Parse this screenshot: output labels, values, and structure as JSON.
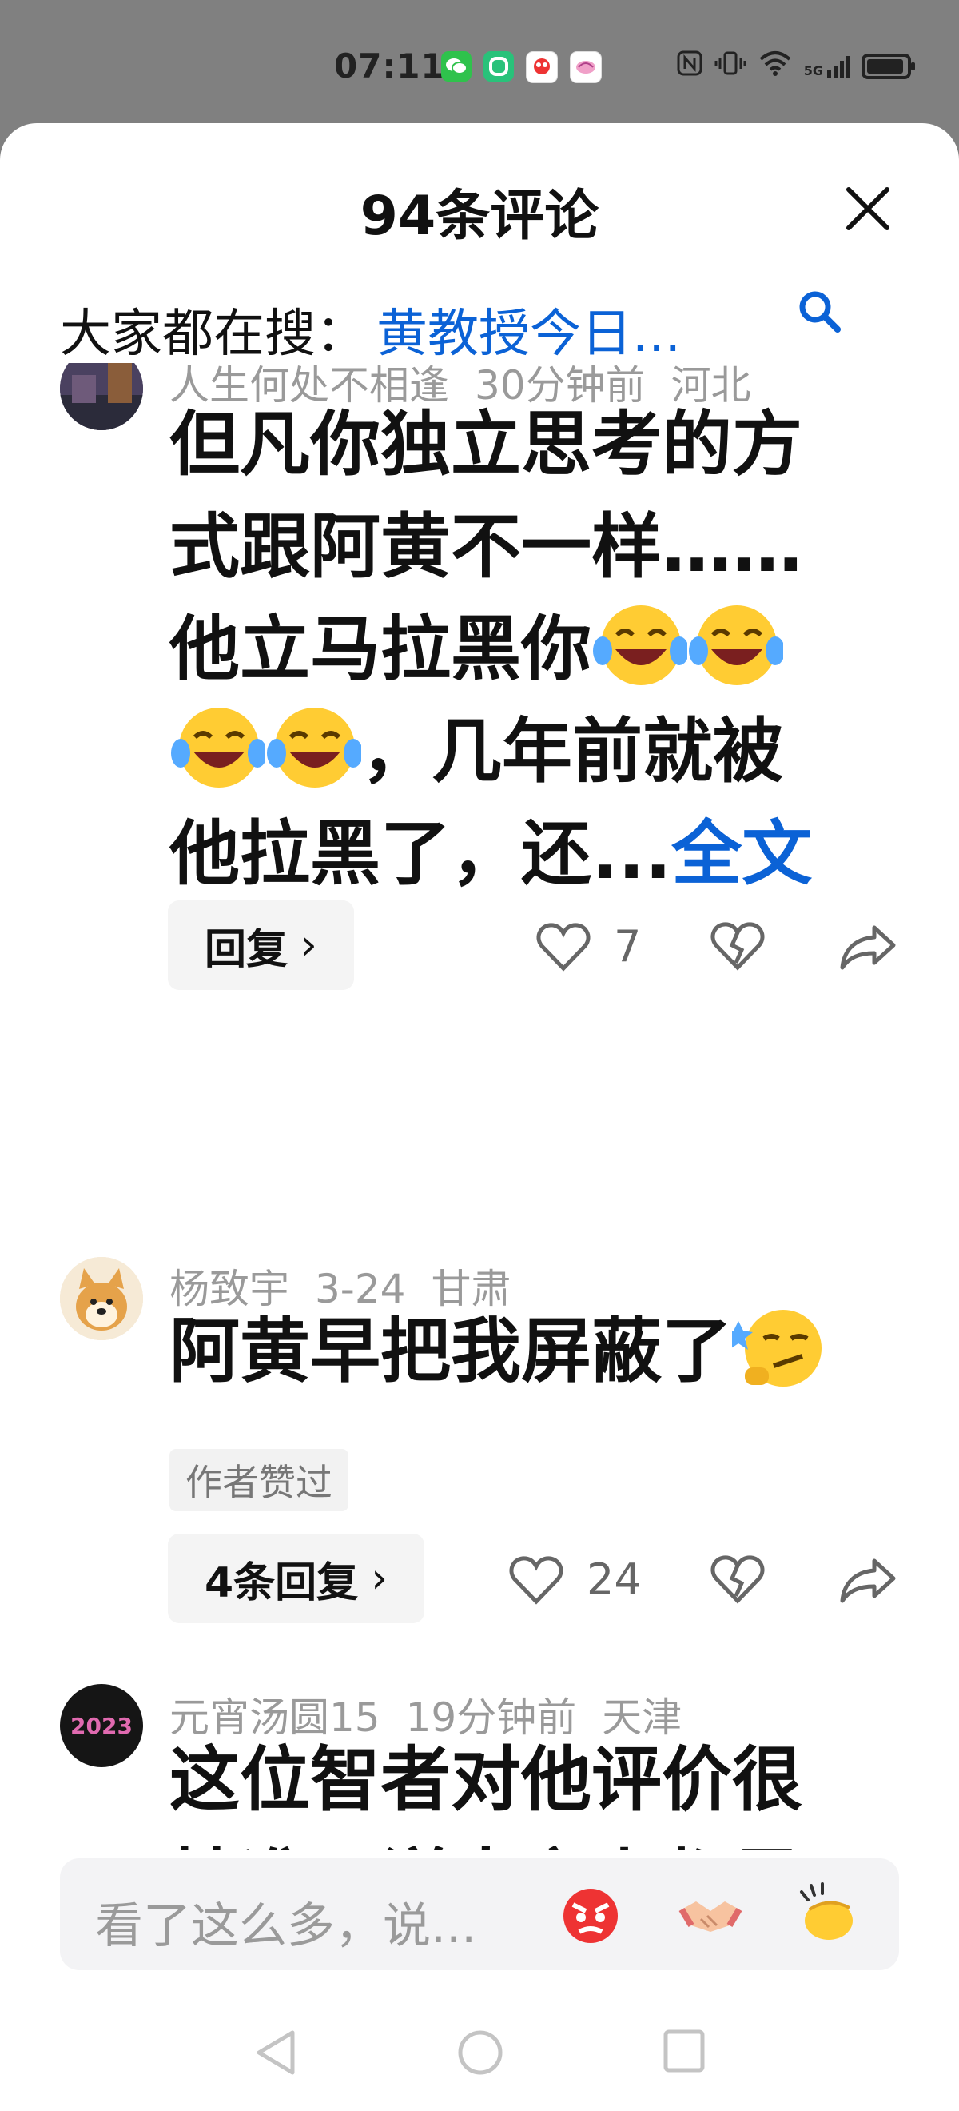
{
  "status_bar": {
    "time": "07:11",
    "app_icons": [
      "wechat-icon",
      "app-icon",
      "app-icon",
      "app-icon"
    ],
    "network_label": "5G",
    "battery_level": 0.9
  },
  "panel": {
    "title": "94条评论"
  },
  "search": {
    "prefix": "大家都在搜：",
    "term": "黄教授今日..."
  },
  "comments": [
    {
      "username": "人生何处不相逢",
      "time": "30分钟前",
      "location": "河北",
      "text_lines": [
        "但凡你独立思考的方",
        "式跟阿黄不一样……",
        "他立马拉黑你",
        "，几年前就被",
        "他拉黑了，还..."
      ],
      "more_label": "全文",
      "reply_label": "回复",
      "like_count": "7"
    },
    {
      "username": "杨致宇",
      "time": "3-24",
      "location": "甘肃",
      "text": "阿黄早把我屏蔽了",
      "badge": "作者赞过",
      "reply_label": "4条回复",
      "like_count": "24"
    },
    {
      "username": "元宵汤圆15",
      "time": "19分钟前",
      "location": "天津",
      "avatar_text": "2023",
      "text_lines": [
        "这位智者对他评价很",
        "精准：洋人之上都是"
      ]
    }
  ],
  "input": {
    "placeholder": "看了这么多，说..."
  },
  "colors": {
    "accent": "#0b62d6",
    "meta": "#9a9a9a"
  }
}
